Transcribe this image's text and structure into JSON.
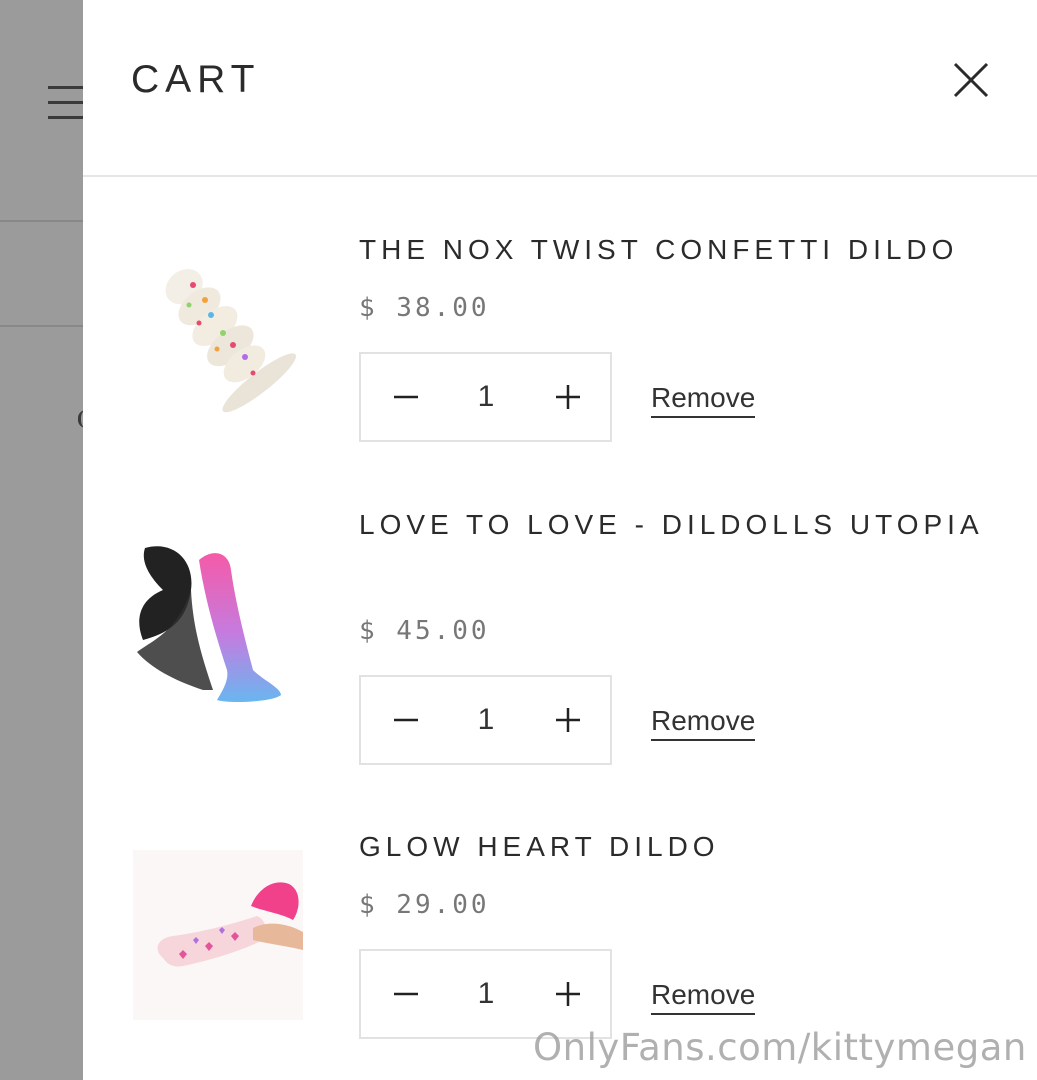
{
  "cart": {
    "title": "CART",
    "close_icon": "close-icon"
  },
  "items": [
    {
      "title": "THE NOX TWIST CONFETTI DILDO",
      "price": "$ 38.00",
      "quantity": "1",
      "remove_label": "Remove"
    },
    {
      "title": "LOVE TO LOVE - DILDOLLS UTOPIA",
      "price": "$ 45.00",
      "quantity": "1",
      "remove_label": "Remove"
    },
    {
      "title": "GLOW HEART DILDO",
      "price": "$ 29.00",
      "quantity": "1",
      "remove_label": "Remove"
    }
  ],
  "watermark": "OnlyFans.com/kittymegan",
  "colors": {
    "drawer_bg": "#ffffff",
    "overlay_bg": "#9b9b9b",
    "text": "#2b2b2b",
    "price_text": "#777777"
  }
}
